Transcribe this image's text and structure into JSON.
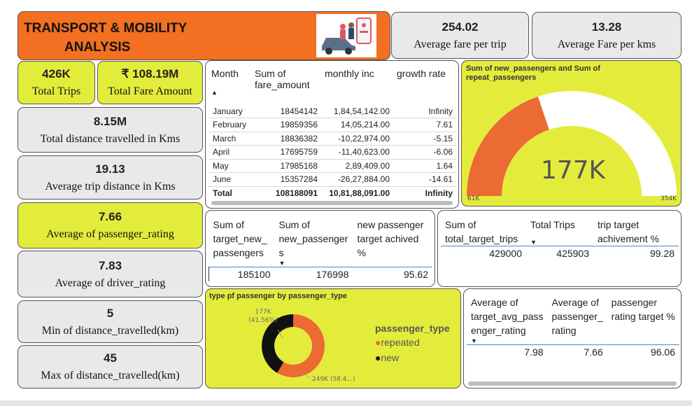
{
  "header": {
    "title_line1": "TRANSPORT & MOBILITY",
    "title_line2": "ANALYSIS"
  },
  "kpis": {
    "avg_fare_trip": {
      "value": "254.02",
      "label": "Average fare per trip"
    },
    "avg_fare_km": {
      "value": "13.28",
      "label": "Average Fare per kms"
    },
    "total_trips": {
      "value": "426K",
      "label": "Total Trips"
    },
    "total_fare": {
      "value": "₹ 108.19M",
      "label": "Total Fare Amount"
    },
    "total_distance": {
      "value": "8.15M",
      "label": "Total distance travelled in Kms"
    },
    "avg_trip_distance": {
      "value": "19.13",
      "label": "Average trip distance in Kms"
    },
    "avg_passenger_rating": {
      "value": "7.66",
      "label": "Average of passenger_rating"
    },
    "avg_driver_rating": {
      "value": "7.83",
      "label": "Average of driver_rating"
    },
    "min_distance": {
      "value": "5",
      "label": "Min of distance_travelled(km)"
    },
    "max_distance": {
      "value": "45",
      "label": "Max of distance_travelled(km)"
    }
  },
  "monthly_table": {
    "headers": {
      "month": "Month",
      "sum_fare": "Sum of fare_amount",
      "monthly_inc": "monthly inc",
      "growth": "growth rate"
    },
    "rows": [
      {
        "month": "January",
        "fare": "18454142",
        "inc": "1,84,54,142.00",
        "growth": "Infinity"
      },
      {
        "month": "February",
        "fare": "19859356",
        "inc": "14,05,214.00",
        "growth": "7.61"
      },
      {
        "month": "March",
        "fare": "18836382",
        "inc": "-10,22,974.00",
        "growth": "-5.15"
      },
      {
        "month": "April",
        "fare": "17695759",
        "inc": "-11,40,623.00",
        "growth": "-6.06"
      },
      {
        "month": "May",
        "fare": "17985168",
        "inc": "2,89,409.00",
        "growth": "1.64"
      },
      {
        "month": "June",
        "fare": "15357284",
        "inc": "-26,27,884.00",
        "growth": "-14.61"
      }
    ],
    "total": {
      "label": "Total",
      "fare": "108188091",
      "inc": "10,81,88,091.00",
      "growth": "Infinity"
    }
  },
  "gauge": {
    "title": "Sum of new_passengers and Sum of repeat_passengers",
    "value_label": "177K",
    "min_label": "61K",
    "max_label": "354K",
    "min": 61000,
    "max": 354000,
    "value": 177000,
    "fill_color": "#ec6a34",
    "track_color": "#ffffff"
  },
  "new_passenger_table": {
    "h1": "Sum of target_new_ passengers",
    "h2": "Sum of new_passenger s",
    "h3": "new passenger target achived %",
    "v1": "185100",
    "v2": "176998",
    "v3": "95.62"
  },
  "trip_target_table": {
    "h1": "Sum of total_target_trips",
    "h2": "Total Trips",
    "h3": "trip target achivement %",
    "v1": "429000",
    "v2": "425903",
    "v3": "99.28"
  },
  "rating_table": {
    "h1": "Average of target_avg_pass enger_rating",
    "h2": "Average of passenger_ rating",
    "h3": "passenger rating target %",
    "v1": "7.98",
    "v2": "7.66",
    "v3": "96.06"
  },
  "chart_data": {
    "type": "pie",
    "title": "type pf passenger by passenger_type",
    "legend_title": "passenger_type",
    "legend_position": "right",
    "categories": [
      "repeated",
      "new"
    ],
    "values": [
      249,
      177
    ],
    "unit": "K",
    "data_labels": [
      "249K (58.4...)",
      "177K (41.56%)"
    ],
    "colors": {
      "repeated": "#ec6a34",
      "new": "#111111"
    }
  }
}
